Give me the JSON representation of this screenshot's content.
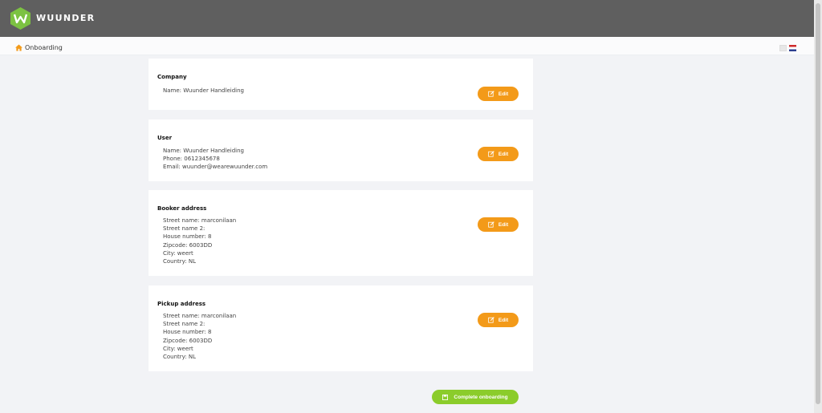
{
  "app": {
    "brand": "WUUNDER"
  },
  "breadcrumb": {
    "label": "Onboarding"
  },
  "language_flags": [
    "en-flag-icon",
    "nl-flag-icon"
  ],
  "cards": [
    {
      "title": "Company",
      "lines": [
        "Name: Wuunder Handleiding"
      ],
      "edit_label": "Edit"
    },
    {
      "title": "User",
      "lines": [
        "Name: Wuunder Handleiding",
        "Phone: 0612345678",
        "Email: wuunder@wearewuunder.com"
      ],
      "edit_label": "Edit"
    },
    {
      "title": "Booker address",
      "lines": [
        "Street name: marconilaan",
        "Street name 2:",
        "House number: 8",
        "Zipcode: 6003DD",
        "City: weert",
        "Country: NL"
      ],
      "edit_label": "Edit"
    },
    {
      "title": "Pickup address",
      "lines": [
        "Street name: marconilaan",
        "Street name 2:",
        "House number: 8",
        "Zipcode: 6003DD",
        "City: weert",
        "Country: NL"
      ],
      "edit_label": "Edit"
    }
  ],
  "complete_button": {
    "label": "Complete onboarding"
  },
  "colors": {
    "accent": "#f39a19",
    "success": "#8bcc2b",
    "header": "#5f5f5f",
    "logo": "#7cc242"
  }
}
